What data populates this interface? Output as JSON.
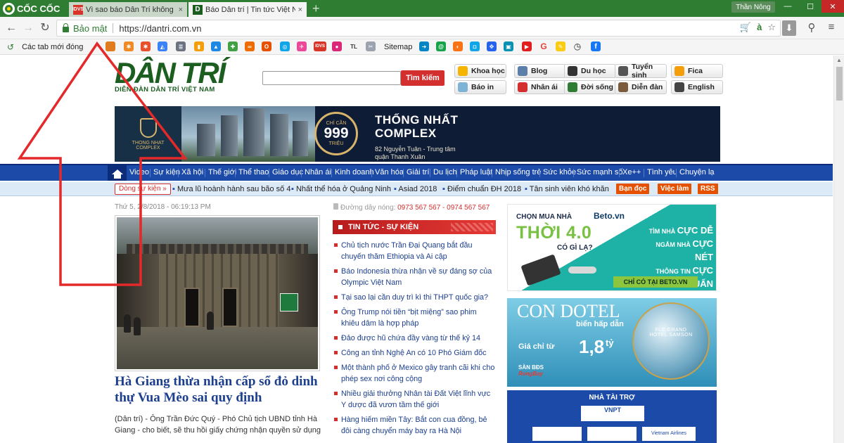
{
  "browser": {
    "brand": "CỐC CỐC",
    "tabs": [
      {
        "favicon": "IDVS",
        "title": "Vì sao báo Dân Trí không",
        "close": "×"
      },
      {
        "favicon": "D",
        "title": "Báo Dân trí | Tin tức Việt N",
        "close": "×"
      }
    ],
    "user_label": "Thần Nông",
    "secure_label": "Bảo mật",
    "url": "https://dantri.com.vn",
    "omnibox_lang": "à",
    "bookmarks": {
      "apps_label": "Các tab mới đóng",
      "idvs": "IDVS",
      "tl": "TL",
      "sitemap": "Sitemap",
      "g": "G"
    }
  },
  "site": {
    "logo": "DÂN TRÍ",
    "logo_sub": "DIỄN ĐÀN DÂN TRÍ VIỆT NAM",
    "search_button": "Tìm kiếm",
    "quick_links": [
      "Khoa học",
      "Blog",
      "Du học",
      "Tuyển sinh",
      "Fica",
      "Báo in",
      "Nhân ái",
      "Đời sống",
      "Diễn đàn",
      "English"
    ]
  },
  "banner": {
    "brand": "THONG NHAT",
    "brand_sub": "COMPLEX",
    "ring_top": "CHỈ CẦN",
    "ring_value": "999",
    "ring_unit": "TRIỆU",
    "title_line1": "THỐNG NHẤT",
    "title_line2": "COMPLEX",
    "address_line1": "82 Nguyễn Tuân - Trung tâm",
    "address_line2": "quận Thanh Xuân"
  },
  "nav": {
    "items": [
      "Video",
      "Sự kiện",
      "Xã hội",
      "Thế giới",
      "Thể thao",
      "Giáo dục",
      "Nhân ái",
      "Kinh doanh",
      "Văn hóa",
      "Giải trí",
      "Du lịch",
      "Pháp luật",
      "Nhịp sống trẻ",
      "Sức khỏe",
      "Sức mạnh số",
      "Xe++",
      "Tình yêu",
      "Chuyện lạ"
    ]
  },
  "subnav": {
    "events_button": "Dòng sự kiện »",
    "hot_topics": [
      "Mưa lũ hoành hành sau bão số 4",
      "Nhất thể hóa ở Quảng Ninh",
      "Asiad 2018",
      "Điểm chuẩn ĐH 2018",
      "Tân sinh viên khó khăn"
    ],
    "tags": [
      "Bạn đọc",
      "Việc làm",
      "RSS"
    ]
  },
  "article": {
    "dateline": "Thứ 5, 2/8/2018 - 06:19:13 PM",
    "headline": "Hà Giang thừa nhận cấp sổ đỏ dinh thự Vua Mèo sai quy định",
    "lead": "(Dân trí) - Ông Trần Đức Quý - Phó Chủ tịch UBND tỉnh Hà Giang - cho biết, sẽ thu hồi giấy chứng nhận quyền sử dụng"
  },
  "news": {
    "hotline_label": "Đường dây nóng:",
    "hotline_numbers": "0973 567 567 - 0974 567 567",
    "section_title": "TIN TỨC - SỰ KIỆN",
    "items": [
      "Chủ tịch nước Trần Đại Quang bắt đầu chuyến thăm Ethiopia và Ai cập",
      "Báo Indonesia thừa nhận về sự đáng sợ của Olympic Việt Nam",
      "Tại sao lại cần duy trì kì thi THPT quốc gia?",
      "Ông Trump nói tiền “bịt miệng” sao phim khiêu dâm là hợp pháp",
      "Đảo được hũ chứa đầy vàng từ thế kỷ 14",
      "Công an tỉnh Nghệ An có 10 Phó Giám đốc",
      "Một thành phố ở Mexico gây tranh cãi khi cho phép sex nơi công cộng",
      "Nhiều giải thưởng Nhân tài Đất Việt lĩnh vực Y dược đã vươn tầm thế giới",
      "Hàng hiếm miền Tây: Bắt con cua đồng, bẻ đôi càng chuyển máy bay ra Hà Nội"
    ]
  },
  "ads": {
    "beto": {
      "line1": "CHỌN MUA NHÀ",
      "line2": "THỜI 4.0",
      "line3": "CÓ GÌ LẠ?",
      "logo": "Beto.vn",
      "r1a": "TÌM NHÀ",
      "r1b": "CỰC DỄ",
      "r2a": "NGẮM NHÀ",
      "r2b": "CỰC NÉT",
      "r3a": "THÔNG TIN",
      "r3b": "CỰC CHUẨN",
      "footer": "CHỈ CÓ TẠI BETO.VN"
    },
    "condotel": {
      "title": "CON DOTEL",
      "subtitle": "biển hấp dẫn",
      "price_label": "Giá chỉ từ",
      "price_value": "1,8",
      "price_unit": "tỷ",
      "orb_text": "FLC GRAND HOTEL SAMSON",
      "sub1": "SÀN BĐS",
      "sub2": "RongBay"
    },
    "sponsor": {
      "title": "NHÀ TÀI TRỢ",
      "vnpt": "VNPT",
      "airline": "Vietnam Airlines"
    }
  },
  "colors": {
    "brand_green": "#1b5e20",
    "nav_blue": "#1c4aa8",
    "news_red": "#d32f2f",
    "annotation_red": "#e32929"
  }
}
